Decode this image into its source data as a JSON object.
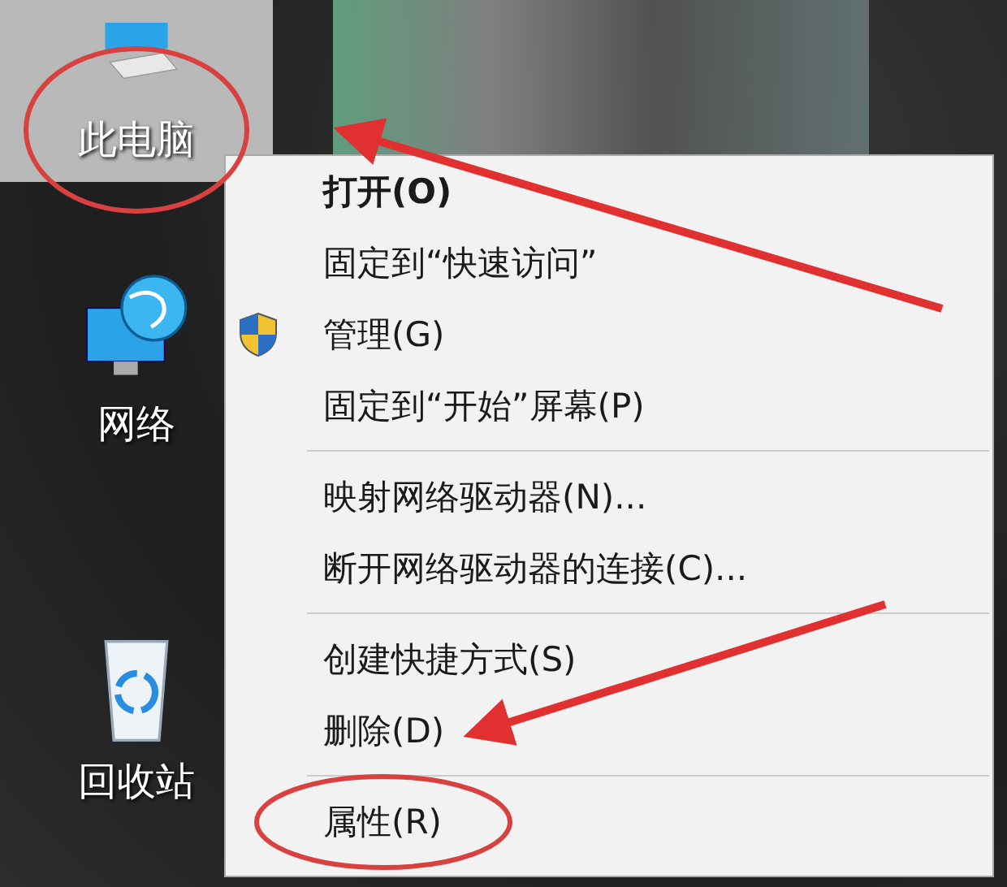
{
  "desktop_icons": [
    {
      "kind": "computer",
      "label": "此电脑",
      "selected": true
    },
    {
      "kind": "network",
      "label": "网络",
      "selected": false
    },
    {
      "kind": "recycle",
      "label": "回收站",
      "selected": false
    }
  ],
  "context_menu": {
    "groups": [
      {
        "items": [
          {
            "kind": "default",
            "label": "打开(O)"
          },
          {
            "kind": "command",
            "label": "固定到“快速访问”"
          },
          {
            "kind": "admin",
            "label": "管理(G)"
          },
          {
            "kind": "command",
            "label": "固定到“开始”屏幕(P)"
          }
        ]
      },
      {
        "items": [
          {
            "kind": "command",
            "label": "映射网络驱动器(N)..."
          },
          {
            "kind": "command",
            "label": "断开网络驱动器的连接(C)..."
          }
        ]
      },
      {
        "items": [
          {
            "kind": "command",
            "label": "创建快捷方式(S)"
          },
          {
            "kind": "command",
            "label": "删除(D)"
          }
        ]
      },
      {
        "items": [
          {
            "kind": "command",
            "label": "属性(R)"
          }
        ]
      }
    ]
  }
}
